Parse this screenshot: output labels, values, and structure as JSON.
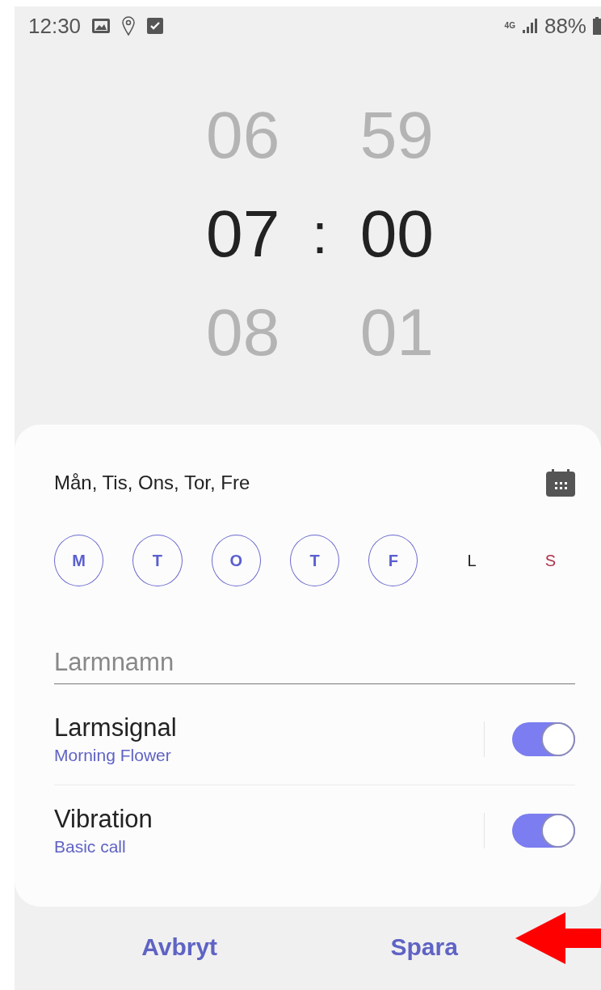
{
  "status_bar": {
    "time": "12:30",
    "network": "4G",
    "battery": "88%"
  },
  "time_picker": {
    "hours": [
      "06",
      "07",
      "08"
    ],
    "separator": ":",
    "minutes": [
      "59",
      "00",
      "01"
    ]
  },
  "alarm_card": {
    "repeat_summary": "Mån, Tis, Ons, Tor, Fre",
    "days": [
      {
        "label": "M",
        "selected": true,
        "kind": "weekday"
      },
      {
        "label": "T",
        "selected": true,
        "kind": "weekday"
      },
      {
        "label": "O",
        "selected": true,
        "kind": "weekday"
      },
      {
        "label": "T",
        "selected": true,
        "kind": "weekday"
      },
      {
        "label": "F",
        "selected": true,
        "kind": "weekday"
      },
      {
        "label": "L",
        "selected": false,
        "kind": "saturday"
      },
      {
        "label": "S",
        "selected": false,
        "kind": "sunday"
      }
    ],
    "name_field": {
      "placeholder": "Larmnamn"
    },
    "settings": [
      {
        "label": "Larmsignal",
        "value": "Morning Flower",
        "on": true
      },
      {
        "label": "Vibration",
        "value": "Basic call",
        "on": true
      }
    ]
  },
  "buttons": [
    "Avbryt",
    "Spara"
  ]
}
